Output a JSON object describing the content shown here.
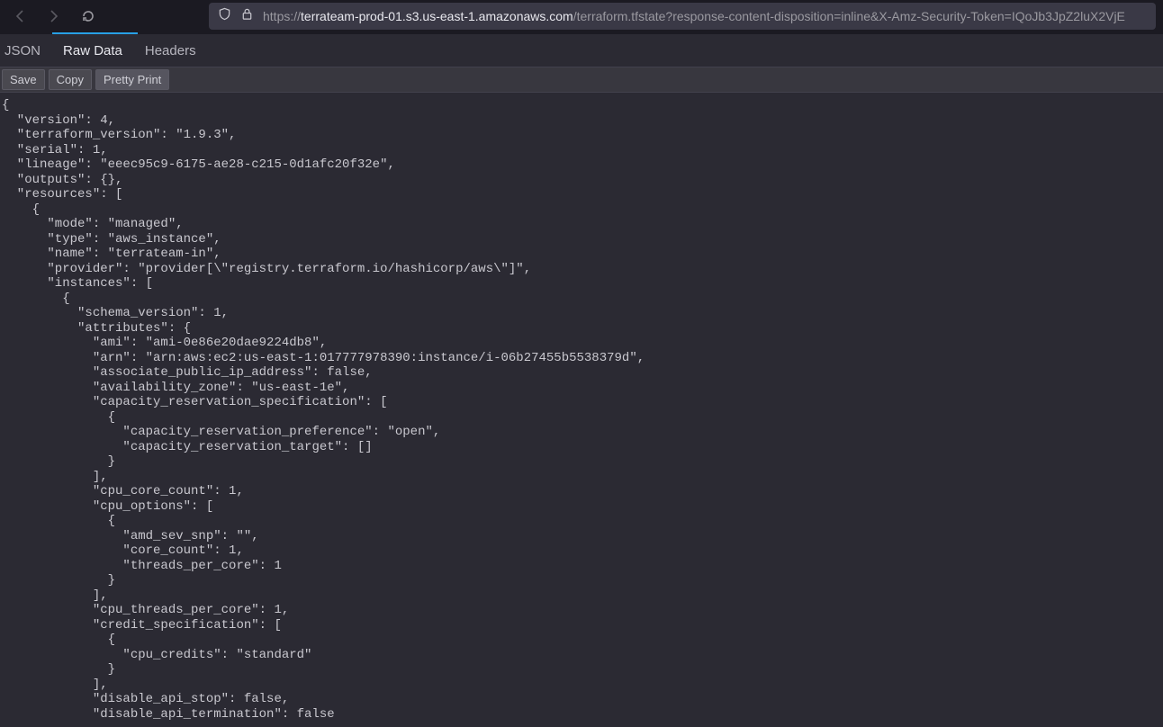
{
  "url": {
    "prefix": "https://",
    "host": "terrateam-prod-01.s3.us-east-1.amazonaws.com",
    "rest": "/terraform.tfstate?response-content-disposition=inline&X-Amz-Security-Token=IQoJb3JpZ2luX2VjE"
  },
  "tabs": {
    "json": "JSON",
    "raw": "Raw Data",
    "headers": "Headers"
  },
  "actions": {
    "save": "Save",
    "copy": "Copy",
    "pretty": "Pretty Print"
  },
  "chart_data": {
    "type": "table",
    "file_type": "terraform_state_json",
    "version": 4,
    "terraform_version": "1.9.3",
    "serial": 1,
    "lineage": "eeec95c9-6175-ae28-c215-0d1afc20f32e",
    "outputs": {},
    "resources": [
      {
        "mode": "managed",
        "type": "aws_instance",
        "name": "terrateam-in",
        "provider": "provider[\"registry.terraform.io/hashicorp/aws\"]",
        "instances": [
          {
            "schema_version": 1,
            "attributes": {
              "ami": "ami-0e86e20dae9224db8",
              "arn": "arn:aws:ec2:us-east-1:017777978390:instance/i-06b27455b5538379d",
              "associate_public_ip_address": false,
              "availability_zone": "us-east-1e",
              "capacity_reservation_specification": [
                {
                  "capacity_reservation_preference": "open",
                  "capacity_reservation_target": []
                }
              ],
              "cpu_core_count": 1,
              "cpu_options": [
                {
                  "amd_sev_snp": "",
                  "core_count": 1,
                  "threads_per_core": 1
                }
              ],
              "cpu_threads_per_core": 1,
              "credit_specification": [
                {
                  "cpu_credits": "standard"
                }
              ],
              "disable_api_stop": false,
              "disable_api_termination": false
            }
          }
        ]
      }
    ]
  },
  "code_text": "{\n  \"version\": 4,\n  \"terraform_version\": \"1.9.3\",\n  \"serial\": 1,\n  \"lineage\": \"eeec95c9-6175-ae28-c215-0d1afc20f32e\",\n  \"outputs\": {},\n  \"resources\": [\n    {\n      \"mode\": \"managed\",\n      \"type\": \"aws_instance\",\n      \"name\": \"terrateam-in\",\n      \"provider\": \"provider[\\\"registry.terraform.io/hashicorp/aws\\\"]\",\n      \"instances\": [\n        {\n          \"schema_version\": 1,\n          \"attributes\": {\n            \"ami\": \"ami-0e86e20dae9224db8\",\n            \"arn\": \"arn:aws:ec2:us-east-1:017777978390:instance/i-06b27455b5538379d\",\n            \"associate_public_ip_address\": false,\n            \"availability_zone\": \"us-east-1e\",\n            \"capacity_reservation_specification\": [\n              {\n                \"capacity_reservation_preference\": \"open\",\n                \"capacity_reservation_target\": []\n              }\n            ],\n            \"cpu_core_count\": 1,\n            \"cpu_options\": [\n              {\n                \"amd_sev_snp\": \"\",\n                \"core_count\": 1,\n                \"threads_per_core\": 1\n              }\n            ],\n            \"cpu_threads_per_core\": 1,\n            \"credit_specification\": [\n              {\n                \"cpu_credits\": \"standard\"\n              }\n            ],\n            \"disable_api_stop\": false,\n            \"disable_api_termination\": false"
}
